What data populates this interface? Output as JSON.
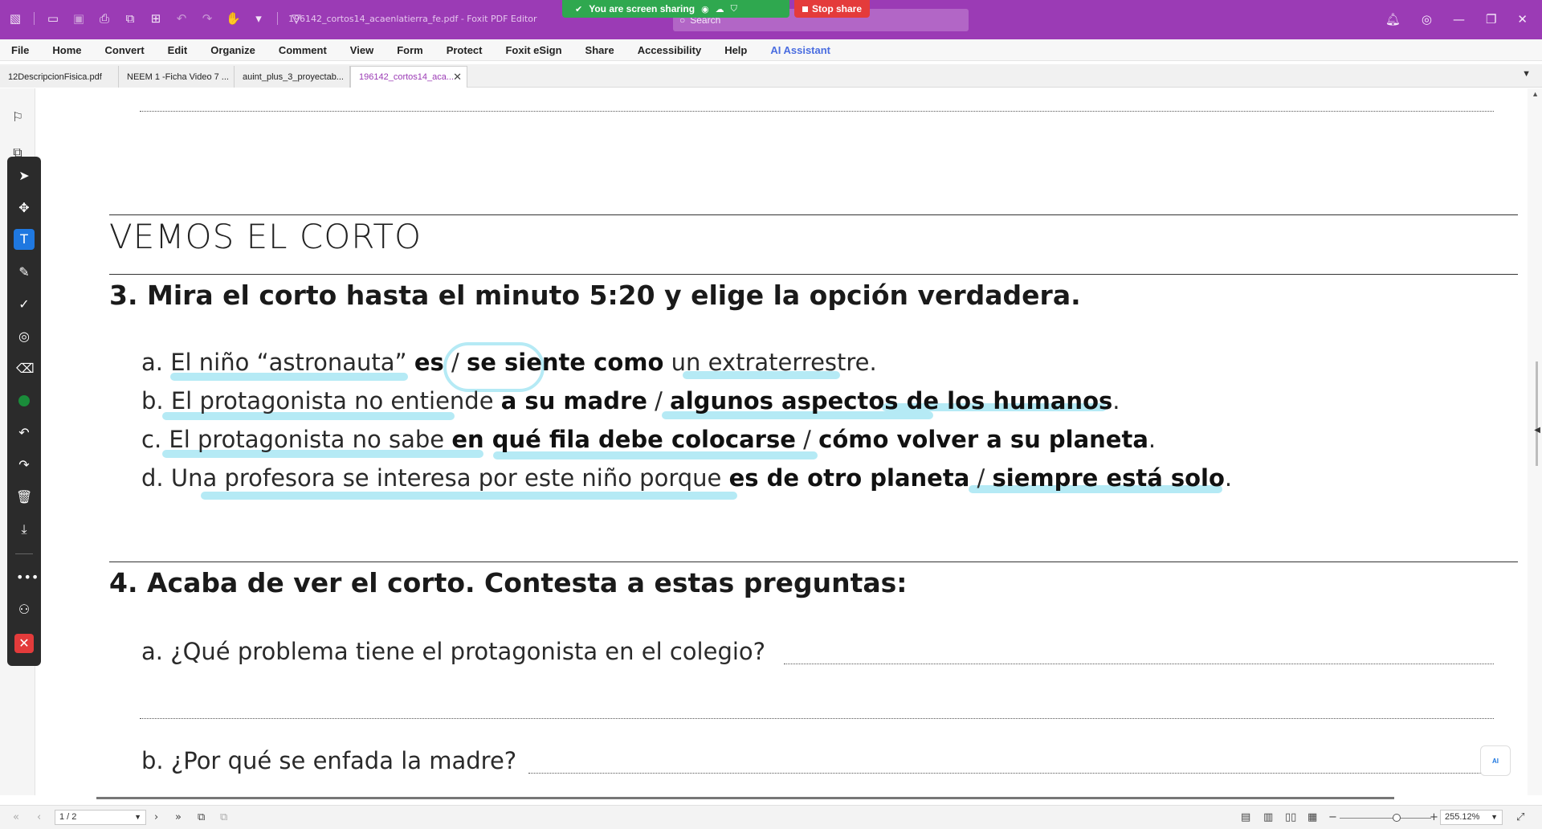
{
  "app": {
    "document_title": "196142_cortos14_acaenlatierra_fe.pdf - Foxit PDF Editor",
    "search_placeholder": "Search",
    "share_text": "You are screen sharing",
    "stop_share": "Stop share",
    "accent": "#9b3bb5"
  },
  "menu": [
    "File",
    "Home",
    "Convert",
    "Edit",
    "Organize",
    "Comment",
    "View",
    "Form",
    "Protect",
    "Foxit eSign",
    "Share",
    "Accessibility",
    "Help",
    "AI Assistant"
  ],
  "tabs": [
    {
      "label": "12DescripcionFisica.pdf"
    },
    {
      "label": "NEEM 1 -Ficha Video  7 ..."
    },
    {
      "label": "auint_plus_3_proyectab..."
    },
    {
      "label": "196142_cortos14_aca..."
    }
  ],
  "doc": {
    "section_title": "VEMOS EL CORTO",
    "q3": "3. Mira el corto hasta el minuto 5:20 y elige la opción verdadera.",
    "q3_options": [
      {
        "prefix": "a. El niño “astronauta” ",
        "opt1": "es",
        "sep": " / ",
        "opt2": "se siente",
        "mid": " como",
        "suffix": " un extraterrestre."
      },
      {
        "prefix": "b. El protagonista no entiende ",
        "opt1": "a su madre",
        "sep": " / ",
        "opt2": "algunos aspectos de los humanos",
        "mid": "",
        "suffix": "."
      },
      {
        "prefix": "c. El protagonista no sabe ",
        "opt1": "en qué fila debe colocarse",
        "sep": " / ",
        "opt2": "cómo volver a su planeta",
        "mid": "",
        "suffix": "."
      },
      {
        "prefix": "d. Una profesora se interesa por este niño porque ",
        "opt1": "es de otro planeta",
        "sep": " / ",
        "opt2": "siempre está solo",
        "mid": "",
        "suffix": "."
      }
    ],
    "q4": "4. Acaba de ver el corto. Contesta a estas preguntas:",
    "q4_a": "a.  ¿Qué problema tiene el protagonista en el colegio?",
    "q4_b": "b. ¿Por qué se enfada la madre?"
  },
  "status": {
    "page": "1 / 2",
    "zoom": "255.12%"
  }
}
